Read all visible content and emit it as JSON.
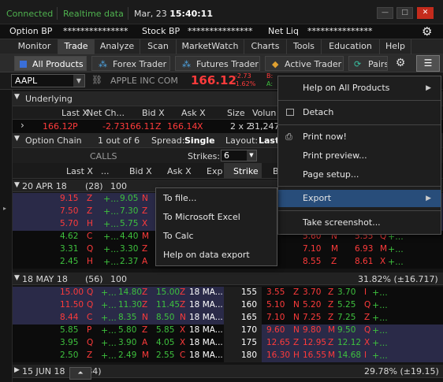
{
  "status": {
    "connected": "Connected",
    "realtime": "Realtime data",
    "date": "Mar, 23",
    "time": "15:40:11"
  },
  "window_buttons": {
    "minimize": "—",
    "maximize": "□",
    "close": "✕"
  },
  "account": {
    "option_bp_label": "Option BP",
    "option_bp_value": "***************",
    "stock_bp_label": "Stock BP",
    "stock_bp_value": "***************",
    "net_liq_label": "Net Liq",
    "net_liq_value": "***************"
  },
  "nav_tabs": [
    "Monitor",
    "Trade",
    "Analyze",
    "Scan",
    "MarketWatch",
    "Charts",
    "Tools",
    "Education",
    "Help"
  ],
  "sub_tabs": [
    "All Products",
    "Forex Trader",
    "Futures Trader",
    "Active Trader",
    "Pairs"
  ],
  "symbol": {
    "ticker": "AAPL",
    "company": "APPLE INC COM",
    "price": "166.12",
    "change": "-2.73",
    "change_pct": "-1.62%",
    "bid_lbl": "B:",
    "ask_lbl": "A:"
  },
  "underlying": {
    "title": "Underlying",
    "headers": [
      "Last X",
      "Net Ch...",
      "Bid X",
      "Ask X",
      "Size",
      "Volun"
    ],
    "row": {
      "last": "166.12",
      "last_x": "P",
      "net": "-2.73",
      "bid": "166.11",
      "bid_x": "Z",
      "ask": "166.14",
      "ask_x": "X",
      "size": "2 x 2",
      "volume": "31,247,"
    }
  },
  "option_chain": {
    "title": "Option Chain",
    "page": "1 out of 6",
    "spread_label": "Spread:",
    "spread_value": "Single",
    "layout_label": "Layout:",
    "layout_value": "Last",
    "strikes_label": "Strikes:",
    "strikes_value": "6",
    "calls_label": "CALLS",
    "col_headers": {
      "last_x": "Last X",
      "mid": "...",
      "bid_x": "Bid X",
      "ask_x": "Ask X",
      "exp": "Exp",
      "strike": "Strike",
      "b": "B"
    }
  },
  "series": [
    {
      "label": "20 APR 18",
      "days": "(28)",
      "mult": "100"
    },
    {
      "label": "18 MAY 18",
      "days": "(56)",
      "mult": "100",
      "iv": "31.82% (±16.717)"
    },
    {
      "label": "15 JUN 18",
      "days": "(84)",
      "mult": "",
      "iv": "29.78% (±19.15)"
    }
  ],
  "apr_rows": [
    [
      "9.15",
      "Z",
      "9.05",
      "N"
    ],
    [
      "7.50",
      "Z",
      "7.30",
      "Z"
    ],
    [
      "5.70",
      "H",
      "5.75",
      "X"
    ],
    [
      "4.62",
      "C",
      "4.40",
      "M"
    ],
    [
      "3.31",
      "Q",
      "3.30",
      "Z"
    ],
    [
      "2.45",
      "H",
      "2.37",
      "A"
    ]
  ],
  "apr_put_rows": [
    [
      "",
      "",
      "",
      ""
    ],
    [
      "",
      "",
      "",
      ""
    ],
    [
      "",
      "",
      "",
      ""
    ],
    [
      "",
      "",
      "",
      ""
    ],
    [
      "5.60",
      "N",
      "5.55",
      "Q"
    ],
    [
      "7.10",
      "M",
      "6.93",
      "M"
    ],
    [
      "8.55",
      "Z",
      "8.61",
      "X"
    ]
  ],
  "may_rows": [
    {
      "last": "15.00",
      "lx": "Q",
      "bid": "14.80",
      "bx": "Z",
      "ask": "15.00",
      "ax": "Z",
      "exp": "18 MA...",
      "strike": "155",
      "pbid": "3.55",
      "pbx": "Z",
      "pask": "3.70",
      "pax": "Z",
      "plast": "3.70",
      "plx": "I"
    },
    {
      "last": "11.50",
      "lx": "Q",
      "bid": "11.30",
      "bx": "Z",
      "ask": "11.45",
      "ax": "Z",
      "exp": "18 MA...",
      "strike": "160",
      "pbid": "5.10",
      "pbx": "N",
      "pask": "5.20",
      "pax": "Z",
      "plast": "5.25",
      "plx": "Q"
    },
    {
      "last": "8.44",
      "lx": "C",
      "bid": "8.35",
      "bx": "N",
      "ask": "8.50",
      "ax": "N",
      "exp": "18 MA...",
      "strike": "165",
      "pbid": "7.10",
      "pbx": "N",
      "pask": "7.25",
      "pax": "Z",
      "plast": "7.25",
      "plx": "Z"
    },
    {
      "last": "5.85",
      "lx": "P",
      "bid": "5.80",
      "bx": "Z",
      "ask": "5.85",
      "ax": "X",
      "exp": "18 MA...",
      "strike": "170",
      "pbid": "9.60",
      "pbx": "N",
      "pask": "9.80",
      "pax": "M",
      "plast": "9.50",
      "plx": "Q"
    },
    {
      "last": "3.95",
      "lx": "Q",
      "bid": "3.90",
      "bx": "A",
      "ask": "4.05",
      "ax": "X",
      "exp": "18 MA...",
      "strike": "175",
      "pbid": "12.65",
      "pbx": "Z",
      "pask": "12.95",
      "pax": "Z",
      "plast": "12.12",
      "plx": "X"
    },
    {
      "last": "2.50",
      "lx": "Z",
      "bid": "2.49",
      "bx": "M",
      "ask": "2.55",
      "ax": "C",
      "exp": "18 MA...",
      "strike": "180",
      "pbid": "16.30",
      "pbx": "H",
      "pask": "16.55",
      "pax": "M",
      "plast": "14.68",
      "plx": "I"
    }
  ],
  "plus": "+...",
  "main_menu": {
    "help": "Help on All Products",
    "detach": "Detach",
    "print_now": "Print now!",
    "print_preview": "Print preview...",
    "page_setup": "Page setup...",
    "export": "Export",
    "screenshot": "Take screenshot..."
  },
  "export_menu": {
    "file": "To file...",
    "excel": "To Microsoft Excel",
    "calc": "To Calc",
    "help": "Help on data export"
  },
  "colors": {
    "accent": "#284d7a",
    "up": "#3ec13e",
    "down": "#ff3b3b",
    "row_band": "#2a2a48"
  }
}
